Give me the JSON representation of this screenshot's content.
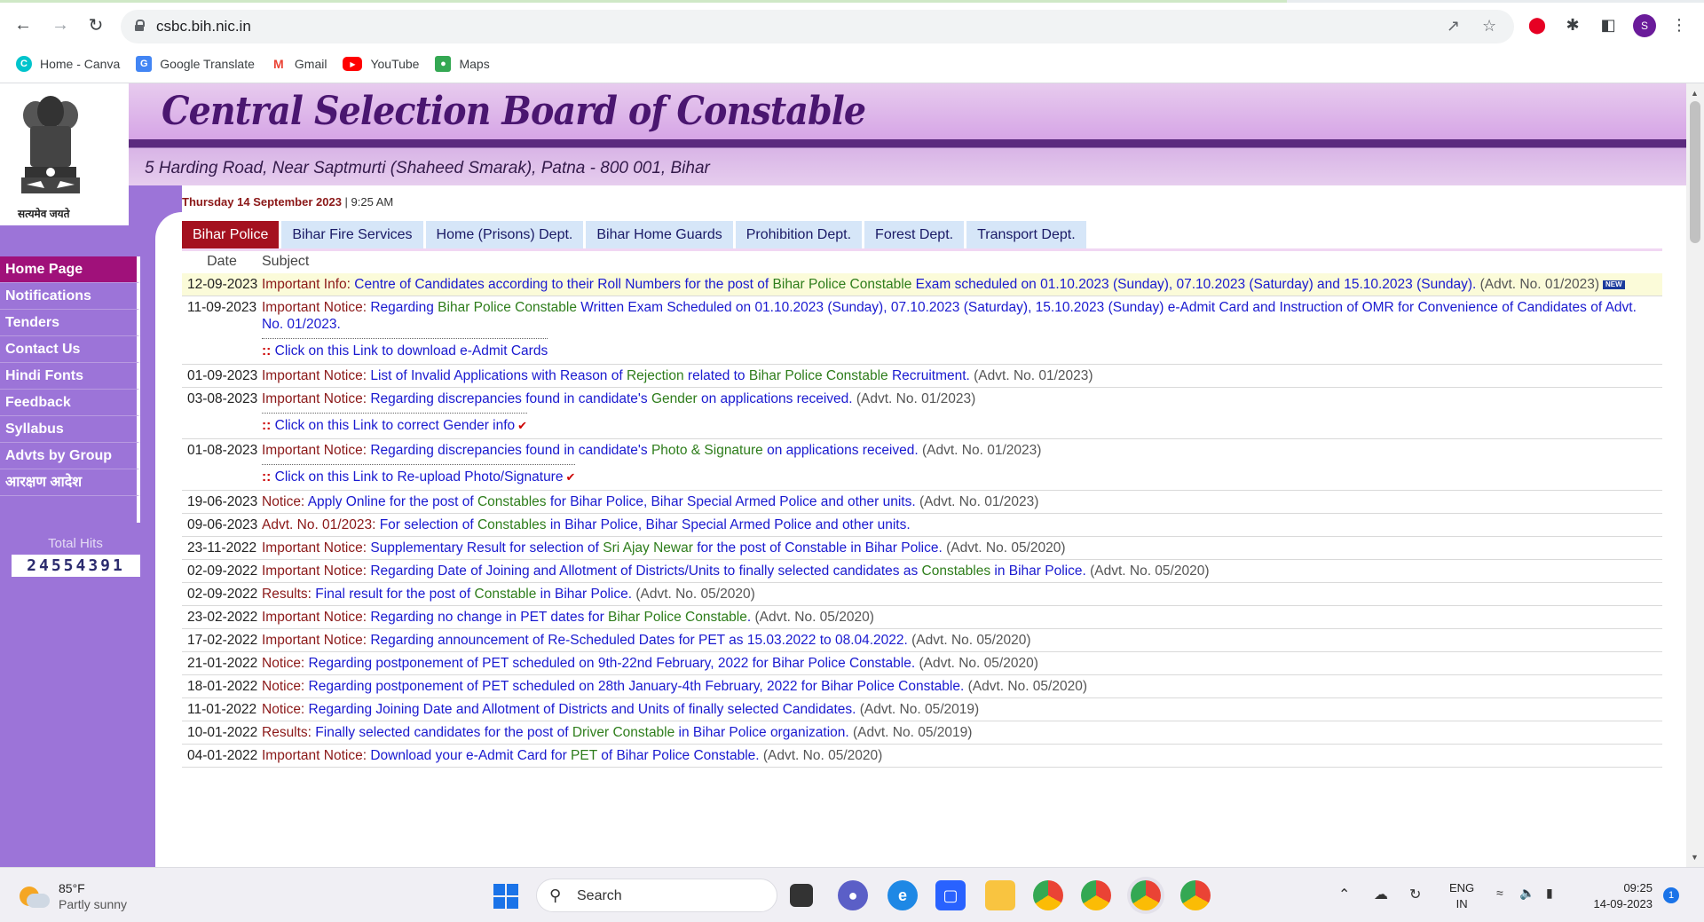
{
  "browser": {
    "url": "csbc.bih.nic.in",
    "bookmarks": [
      "Home - Canva",
      "Google Translate",
      "Gmail",
      "YouTube",
      "Maps"
    ],
    "profile_initial": "S"
  },
  "site": {
    "title": "Central Selection Board of Constable",
    "address": "5 Harding Road, Near Saptmurti (Shaheed Smarak), Patna - 800 001, Bihar",
    "motto": "सत्यमेव जयते",
    "date_label": "Thursday 14 September 2023",
    "time_label": "9:25 AM"
  },
  "menu": [
    "Home Page",
    "Notifications",
    "Tenders",
    "Contact Us",
    "Hindi Fonts",
    "Feedback",
    "Syllabus",
    "Advts by Group",
    "आरक्षण आदेश"
  ],
  "hits": {
    "label": "Total Hits",
    "value": "24554391"
  },
  "tabs": [
    "Bihar Police",
    "Bihar Fire Services",
    "Home (Prisons) Dept.",
    "Bihar Home Guards",
    "Prohibition Dept.",
    "Forest Dept.",
    "Transport Dept."
  ],
  "table": {
    "headers": {
      "date": "Date",
      "subject": "Subject"
    },
    "rows": [
      {
        "date": "12-09-2023",
        "label": "Important Info:",
        "p1": " Centre of Candidates according to their Roll Numbers for the post of ",
        "g1": "Bihar Police Constable",
        "p2": " Exam scheduled on 01.10.2023 (Sunday), 07.10.2023 (Saturday) and 15.10.2023 (Sunday).",
        "adv": " (Advt. No. 01/2023)",
        "new_badge": "NEW"
      },
      {
        "date": "11-09-2023",
        "label": "Important Notice:",
        "p1": " Regarding ",
        "g1": "Bihar Police Constable",
        "p2": " Written Exam Scheduled on 01.10.2023 (Sunday), 07.10.2023 (Saturday), 15.10.2023 (Sunday) e-Admit Card and Instruction of OMR for Convenience of Candidates of Advt. No. 01/2023.",
        "sub_link": "Click on this Link to download e-Admit Cards"
      },
      {
        "date": "01-09-2023",
        "label": "Important Notice:",
        "p1": " List of Invalid Applications with Reason of ",
        "g1": "Rejection",
        "p2": " related to ",
        "g2": "Bihar Police Constable",
        "p3": " Recruitment.",
        "adv": " (Advt. No. 01/2023)"
      },
      {
        "date": "03-08-2023",
        "label": "Important Notice:",
        "p1": " Regarding discrepancies found in candidate's ",
        "g1": "Gender",
        "p2": " on applications received.",
        "adv": " (Advt. No. 01/2023)",
        "sub_link": "Click on this Link to correct Gender info"
      },
      {
        "date": "01-08-2023",
        "label": "Important Notice:",
        "p1": " Regarding discrepancies found in candidate's ",
        "g1": "Photo & Signature",
        "p2": " on applications received.",
        "adv": " (Advt. No. 01/2023)",
        "sub_link": "Click on this Link to Re-upload Photo/Signature"
      },
      {
        "date": "19-06-2023",
        "label": "Notice:",
        "p1": " Apply Online for the post of ",
        "g1": "Constables",
        "p2": " for Bihar Police, Bihar Special Armed Police and other units.",
        "adv": " (Advt. No. 01/2023)"
      },
      {
        "date": "09-06-2023",
        "label": "Advt. No. 01/2023:",
        "p1": " For selection of ",
        "g1": "Constables",
        "p2": " in Bihar Police, Bihar Special Armed Police and other units."
      },
      {
        "date": "23-11-2022",
        "label": "Important Notice:",
        "p1": " Supplementary Result for selection of ",
        "g1": "Sri Ajay Newar",
        "p2": " for the post of Constable in Bihar Police.",
        "adv": " (Advt. No. 05/2020)"
      },
      {
        "date": "02-09-2022",
        "label": "Important Notice:",
        "p1": " Regarding Date of Joining and Allotment of Districts/Units to finally selected candidates as ",
        "g1": "Constables",
        "p2": " in Bihar Police.",
        "adv": " (Advt. No. 05/2020)"
      },
      {
        "date": "02-09-2022",
        "label": "Results:",
        "p1": " Final result for the post of ",
        "g1": "Constable",
        "p2": " in Bihar Police.",
        "adv": " (Advt. No. 05/2020)"
      },
      {
        "date": "23-02-2022",
        "label": "Important Notice:",
        "p1": " Regarding no change in PET dates for ",
        "g1": "Bihar Police Constable",
        "p2": ".",
        "adv": " (Advt. No. 05/2020)"
      },
      {
        "date": "17-02-2022",
        "label": "Important Notice:",
        "p1": " Regarding announcement of Re-Scheduled Dates for PET as 15.03.2022 to 08.04.2022.",
        "adv": " (Advt. No. 05/2020)"
      },
      {
        "date": "21-01-2022",
        "label": "Notice:",
        "p1": " Regarding postponement of PET scheduled on 9th-22nd February, 2022 for Bihar Police Constable.",
        "adv": " (Advt. No. 05/2020)"
      },
      {
        "date": "18-01-2022",
        "label": "Notice:",
        "p1": " Regarding postponement of PET scheduled on 28th January-4th February, 2022 for Bihar Police Constable.",
        "adv": " (Advt. No. 05/2020)"
      },
      {
        "date": "11-01-2022",
        "label": "Notice:",
        "p1": " Regarding Joining Date and Allotment of Districts and Units of finally selected Candidates.",
        "adv": " (Advt. No. 05/2019)"
      },
      {
        "date": "10-01-2022",
        "label": "Results:",
        "p1": " Finally selected candidates for the post of ",
        "g1": "Driver Constable",
        "p2": " in Bihar Police organization.",
        "adv": " (Advt. No. 05/2019)"
      },
      {
        "date": "04-01-2022",
        "label": "Important Notice:",
        "p1": " Download your e-Admit Card for ",
        "g1": "PET",
        "p2": " of Bihar Police Constable.",
        "adv": " (Advt. No. 05/2020)"
      }
    ]
  },
  "taskbar": {
    "weather_temp": "85°F",
    "weather_desc": "Partly sunny",
    "search_label": "Search",
    "lang_line1": "ENG",
    "lang_line2": "IN",
    "time": "09:25",
    "date": "14-09-2023",
    "notification_count": "1"
  },
  "colors": {
    "menu_bg": "#9c74d8",
    "active_tab": "#a4111f",
    "label_red": "#8b1818",
    "link_blue": "#1a1ad0",
    "keyword_green": "#2e7d1b"
  }
}
